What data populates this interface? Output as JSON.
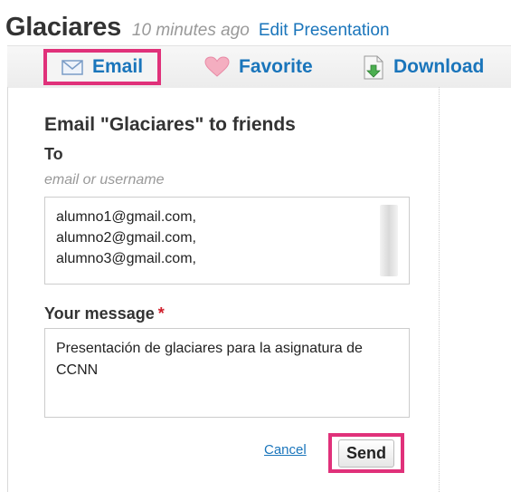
{
  "header": {
    "title": "Glaciares",
    "time": "10 minutes ago",
    "edit_link": "Edit Presentation"
  },
  "toolbar": {
    "email": {
      "label": "Email",
      "icon": "envelope-icon"
    },
    "favorite": {
      "label": "Favorite",
      "icon": "heart-icon"
    },
    "download": {
      "label": "Download",
      "icon": "download-icon"
    }
  },
  "form": {
    "heading": "Email \"Glaciares\" to friends",
    "to_label": "To",
    "to_hint": "email or username",
    "recipients": [
      "alumno1@gmail.com,",
      "alumno2@gmail.com,",
      "alumno3@gmail.com,"
    ],
    "message_label": "Your message",
    "required_mark": "*",
    "message": "Presentación de glaciares para la asignatura de CCNN",
    "cancel_label": "Cancel",
    "send_label": "Send"
  },
  "colors": {
    "link": "#1a75bb",
    "highlight": "#e0317a",
    "required": "#d01f2c"
  }
}
